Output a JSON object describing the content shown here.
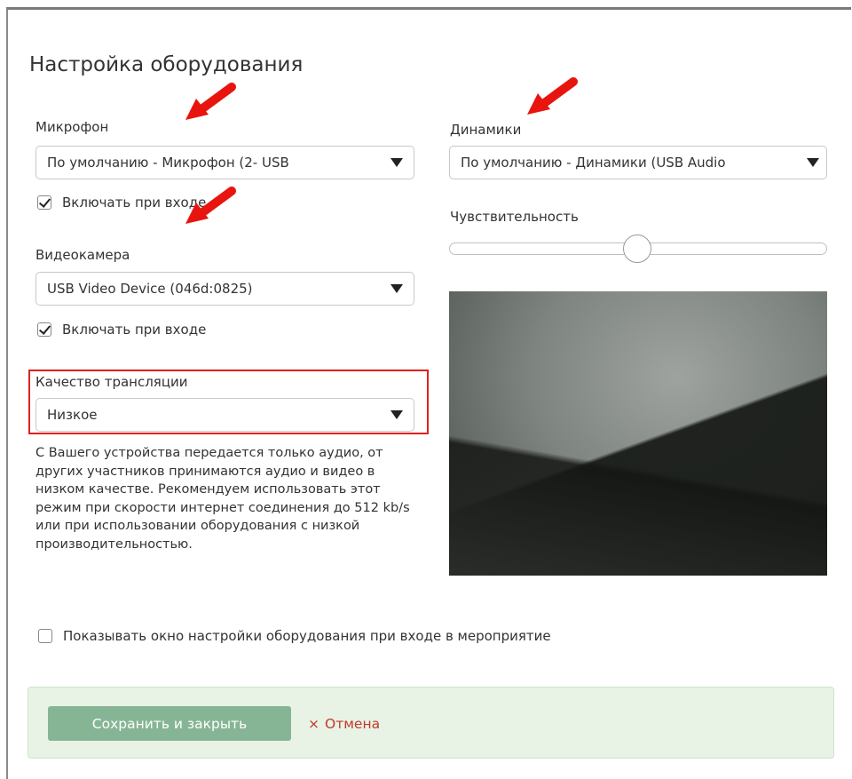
{
  "dialog": {
    "title": "Настройка оборудования"
  },
  "microphone": {
    "label": "Микрофон",
    "selected": "По умолчанию - Микрофон (2- USB",
    "enable_on_entry_label": "Включать при входе",
    "enable_on_entry_checked": true
  },
  "speakers": {
    "label": "Динамики",
    "selected": "По умолчанию - Динамики (USB Audio"
  },
  "sensitivity": {
    "label": "Чувствительность",
    "value_fraction": 0.5
  },
  "camera": {
    "label": "Видеокамера",
    "selected": "USB Video Device (046d:0825)",
    "enable_on_entry_label": "Включать при входе",
    "enable_on_entry_checked": true
  },
  "quality": {
    "label": "Качество трансляции",
    "selected": "Низкое",
    "description": "С Вашего устройства передается только аудио, от других участников принимаются аудио и видео в низком качестве. Рекомендуем использовать этот режим при скорости интернет соединения до 512 kb/s или при использовании оборудования с низкой производительностью."
  },
  "show_settings": {
    "label": "Показывать окно настройки оборудования при входе в мероприятие",
    "checked": false
  },
  "footer": {
    "save_label": "Сохранить и закрыть",
    "cancel_icon": "×",
    "cancel_label": "Отмена"
  },
  "colors": {
    "annotation_red": "#e8150f",
    "save_button": "#86b595",
    "footer_bg": "#e8f3e5",
    "cancel_text": "#c0392b"
  }
}
